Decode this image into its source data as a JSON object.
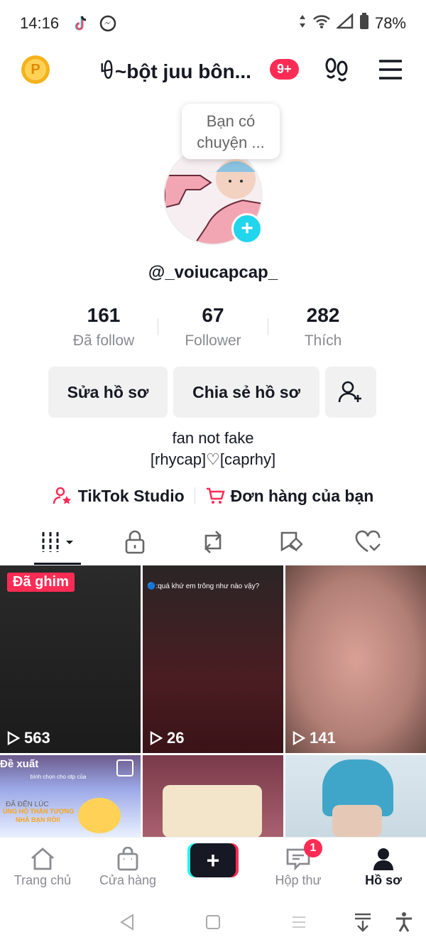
{
  "status_bar": {
    "time": "14:16",
    "battery": "78%"
  },
  "header": {
    "coin_label": "P",
    "title": "ꀺ~bột juu bôn...",
    "badge": "9+"
  },
  "profile": {
    "bubble_text": [
      "Bạn có",
      "chuyện ..."
    ],
    "username": "@_voiucapcap_",
    "stats": [
      {
        "value": "161",
        "label": "Đã follow"
      },
      {
        "value": "67",
        "label": "Follower"
      },
      {
        "value": "282",
        "label": "Thích"
      }
    ],
    "buttons": {
      "edit": "Sửa hồ sơ",
      "share": "Chia sẻ hồ sơ"
    },
    "bio": [
      "fan not fake",
      "[rhycap]♡[caprhy]"
    ],
    "links": {
      "studio": "TikTok Studio",
      "orders": "Đơn hàng của bạn"
    }
  },
  "videos": [
    {
      "views": "563",
      "pinned_label": "Đã ghim"
    },
    {
      "views": "26",
      "caption": "🔵:quá khứ em trông như nào vậy?"
    },
    {
      "views": "141"
    },
    {
      "label": "Đề xuất",
      "promo_top": "bình chọn cho otp của",
      "promo_sub": "ĐÃ ĐẾN LÚC",
      "promo_main": "ỦNG HỘ THẦN TƯỢNG",
      "promo_main2": "NHÀ BẠN RỒI!"
    },
    {},
    {}
  ],
  "bottom_nav": [
    {
      "label": "Trang chủ"
    },
    {
      "label": "Cửa hàng"
    },
    {
      "label": "Hộp thư",
      "badge": "1"
    },
    {
      "label": "Hồ sơ"
    }
  ],
  "colors": {
    "accent": "#fe2c55",
    "cyan": "#20d5ec"
  }
}
